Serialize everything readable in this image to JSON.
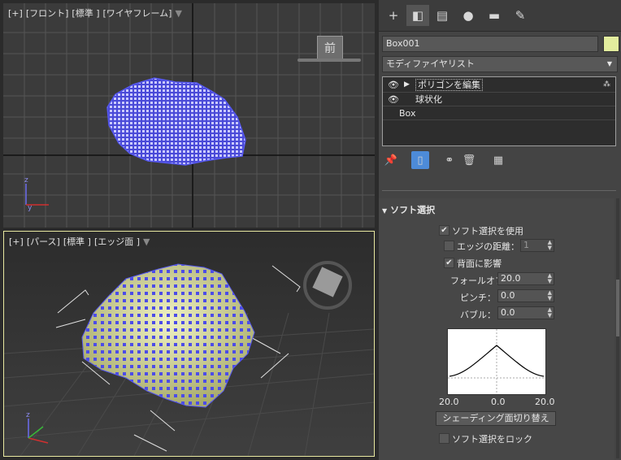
{
  "viewport_front": {
    "labels": [
      "[+]",
      "[フロント]",
      "[標準 ]",
      "[ワイヤフレーム]"
    ],
    "cube_face": "前"
  },
  "viewport_persp": {
    "labels": [
      "[+]",
      "[パース]",
      "[標準 ]",
      "[エッジ面 ]"
    ]
  },
  "tabs": [
    "create-icon",
    "modify-icon",
    "hierarchy-icon",
    "motion-icon",
    "display-icon",
    "utilities-icon"
  ],
  "object": {
    "name": "Box001",
    "color": "#e2ec9e"
  },
  "modifier_list": {
    "label": "モディファイヤリスト"
  },
  "stack": [
    {
      "label": "ポリゴンを編集",
      "selected": true
    },
    {
      "label": "球状化",
      "selected": false
    },
    {
      "label": "Box",
      "selected": false
    }
  ],
  "soft_selection": {
    "title": "ソフト選択",
    "use_label": "ソフト選択を使用",
    "use_checked": true,
    "edge_distance_label": "エッジの距離：",
    "edge_distance_value": "1",
    "edge_distance_checked": false,
    "affect_back_label": "背面に影響",
    "affect_back_checked": true,
    "falloff_label": "フォールオフ：",
    "falloff_value": "20.0",
    "pinch_label": "ピンチ：",
    "pinch_value": "0.0",
    "bubble_label": "バブル：",
    "bubble_value": "0.0",
    "curve_left": "20.0",
    "curve_mid": "0.0",
    "curve_right": "20.0",
    "shaded_face_button": "シェーディング面切り替え",
    "lock_label": "ソフト選択をロック",
    "lock_checked": false
  },
  "colors": {
    "wire": "#5658f0",
    "mesh_fill": "#dfe3a6",
    "selection_border": "#9e9e9e"
  }
}
